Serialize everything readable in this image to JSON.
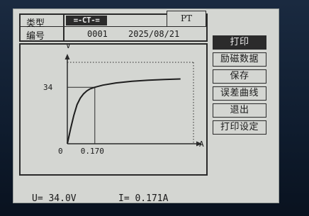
{
  "header": {
    "type_label": "类型",
    "type_tab_ct": "=-CT-=",
    "type_tab_pt": "PT",
    "number_label": "编号",
    "number_value": "0001",
    "date_value": "2025/08/21"
  },
  "chart_data": {
    "type": "line",
    "xlabel": "A",
    "ylabel": "V",
    "origin_label": "0",
    "x_tick_label": "0.170",
    "y_tick_label": "34",
    "marker": {
      "x": 0.17,
      "y": 34
    },
    "series": [
      {
        "values_x": [
          0.0,
          0.02,
          0.04,
          0.06,
          0.08,
          0.1,
          0.12,
          0.14,
          0.17,
          0.22,
          0.3,
          0.4,
          0.5,
          0.6,
          0.7
        ],
        "values_y": [
          0.0,
          9.0,
          17.0,
          23.5,
          27.5,
          30.0,
          31.8,
          33.0,
          34.0,
          35.3,
          36.6,
          37.6,
          38.2,
          38.7,
          39.0
        ]
      }
    ],
    "xlim": [
      0,
      0.78
    ],
    "ylim": [
      0,
      49
    ],
    "grid": false
  },
  "readout": {
    "voltage": "U=  34.0V",
    "current": "I= 0.171A"
  },
  "menu": {
    "items": [
      "打印",
      "励磁数据",
      "保存",
      "误差曲线",
      "退出",
      "打印设定"
    ],
    "active_index": 0
  }
}
